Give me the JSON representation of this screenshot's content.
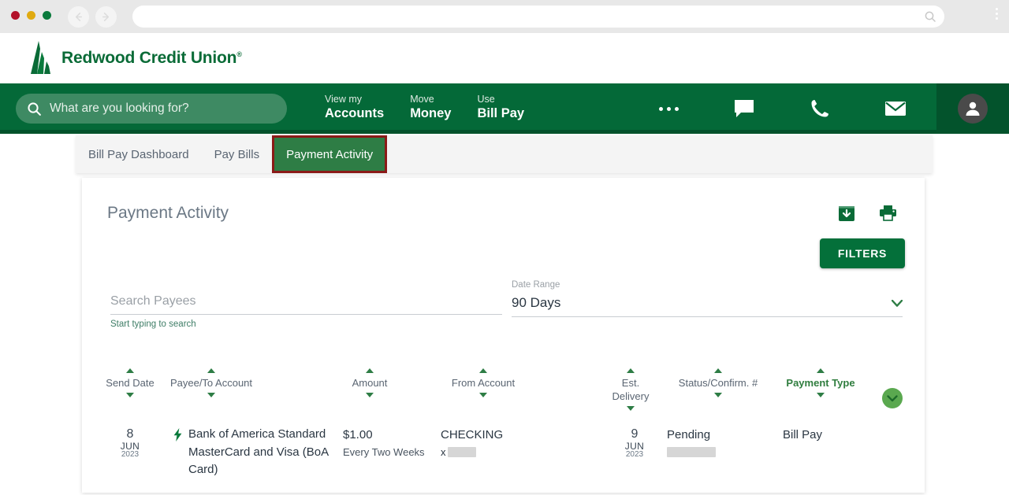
{
  "browser": {
    "traffic_lights": [
      "close-red",
      "minimize-yellow",
      "maximize-green"
    ],
    "back_icon": "back-arrow-icon",
    "forward_icon": "forward-arrow-icon",
    "address_value": "",
    "address_search_icon": "search-icon",
    "menu_icon": "kebab-menu-icon"
  },
  "site_header": {
    "logo_icon": "redwood-tree-logo-icon",
    "brand": "Redwood Credit Union",
    "brand_tm": "®"
  },
  "green_nav": {
    "search_placeholder": "What are you looking for?",
    "search_icon": "search-icon",
    "links": [
      {
        "small": "View my",
        "big": "Accounts"
      },
      {
        "small": "Move",
        "big": "Money"
      },
      {
        "small": "Use",
        "big": "Bill Pay"
      }
    ],
    "icons": [
      {
        "name": "more-options-icon",
        "label": "…"
      },
      {
        "name": "chat-icon",
        "label": ""
      },
      {
        "name": "phone-icon",
        "label": ""
      },
      {
        "name": "mail-icon",
        "label": ""
      }
    ],
    "avatar_icon": "user-avatar-icon"
  },
  "tabs": [
    {
      "label": "Bill Pay Dashboard",
      "active": false
    },
    {
      "label": "Pay Bills",
      "active": false
    },
    {
      "label": "Payment Activity",
      "active": true
    }
  ],
  "card": {
    "title": "Payment Activity",
    "download_icon": "download-icon",
    "print_icon": "print-icon",
    "filters_label": "FILTERS"
  },
  "form": {
    "search_payees_placeholder": "Search Payees",
    "search_payees_value": "",
    "search_payees_hint": "Start typing to search",
    "date_range_label": "Date Range",
    "date_range_value": "90 Days",
    "date_range_caret": "chevron-down-icon"
  },
  "table": {
    "headers": [
      {
        "label": "Send Date",
        "accent": false
      },
      {
        "label": "Payee/To Account",
        "accent": false
      },
      {
        "label": "Amount",
        "accent": false
      },
      {
        "label": "From Account",
        "accent": false
      },
      {
        "label": "Est. Delivery",
        "accent": false
      },
      {
        "label": "Status/Confirm. #",
        "accent": false
      },
      {
        "label": "Payment Type",
        "accent": true
      }
    ],
    "rows": [
      {
        "send_day": "8",
        "send_month": "JUN",
        "send_year": "2023",
        "recurring_icon": "lightning-bolt-icon",
        "payee": "Bank of America Standard MasterCard and Visa (BoA Card)",
        "amount": "$1.00",
        "frequency": "Every Two Weeks",
        "from_account": "CHECKING",
        "from_account_masked": "x",
        "delivery_day": "9",
        "delivery_month": "JUN",
        "delivery_year": "2023",
        "status": "Pending",
        "confirmation_masked": "",
        "payment_type": "Bill Pay",
        "expand_icon": "chevron-down-icon"
      }
    ]
  },
  "colors": {
    "brand_green": "#046938",
    "nav_dark_green": "#02522b",
    "tab_active_green": "#2e7d45",
    "tab_highlight_red": "#8b1a18",
    "filters_green": "#04703a",
    "accent_text_green": "#2f7d3e",
    "expand_green": "#5aa84f"
  }
}
